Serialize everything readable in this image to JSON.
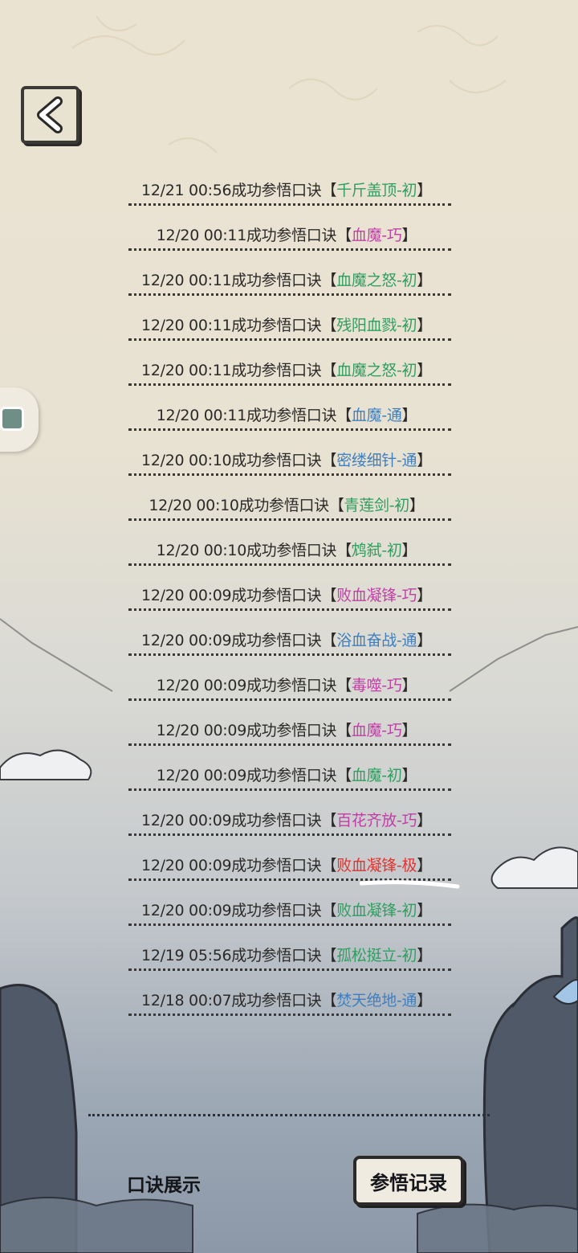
{
  "header": {
    "back_icon": "chevron-left-icon"
  },
  "side_tab": {
    "icon": "book-tab-icon"
  },
  "records": [
    {
      "prefix": "12/21 00:56成功参悟口诀",
      "skill": "千斤盖顶-初",
      "color": "#2f9e5f"
    },
    {
      "prefix": "12/20 00:11成功参悟口诀",
      "skill": "血魔-巧",
      "color": "#c03fa6"
    },
    {
      "prefix": "12/20 00:11成功参悟口诀",
      "skill": "血魔之怒-初",
      "color": "#2f9e5f"
    },
    {
      "prefix": "12/20 00:11成功参悟口诀",
      "skill": "残阳血戮-初",
      "color": "#2f9e5f"
    },
    {
      "prefix": "12/20 00:11成功参悟口诀",
      "skill": "血魔之怒-初",
      "color": "#2f9e5f"
    },
    {
      "prefix": "12/20 00:11成功参悟口诀",
      "skill": "血魔-通",
      "color": "#3f7fc0"
    },
    {
      "prefix": "12/20 00:10成功参悟口诀",
      "skill": "密缕细针-通",
      "color": "#3f7fc0"
    },
    {
      "prefix": "12/20 00:10成功参悟口诀",
      "skill": "青莲剑-初",
      "color": "#2f9e5f"
    },
    {
      "prefix": "12/20 00:10成功参悟口诀",
      "skill": "鸩弑-初",
      "color": "#2f9e5f"
    },
    {
      "prefix": "12/20 00:09成功参悟口诀",
      "skill": "败血凝锋-巧",
      "color": "#c03fa6"
    },
    {
      "prefix": "12/20 00:09成功参悟口诀",
      "skill": "浴血奋战-通",
      "color": "#3f7fc0"
    },
    {
      "prefix": "12/20 00:09成功参悟口诀",
      "skill": "毒噬-巧",
      "color": "#c03fa6"
    },
    {
      "prefix": "12/20 00:09成功参悟口诀",
      "skill": "血魔-巧",
      "color": "#c03fa6"
    },
    {
      "prefix": "12/20 00:09成功参悟口诀",
      "skill": "血魔-初",
      "color": "#2f9e5f"
    },
    {
      "prefix": "12/20 00:09成功参悟口诀",
      "skill": "百花齐放-巧",
      "color": "#c03fa6"
    },
    {
      "prefix": "12/20 00:09成功参悟口诀",
      "skill": "败血凝锋-极",
      "color": "#e0332f"
    },
    {
      "prefix": "12/20 00:09成功参悟口诀",
      "skill": "败血凝锋-初",
      "color": "#2f9e5f"
    },
    {
      "prefix": "12/19 05:56成功参悟口诀",
      "skill": "孤松挺立-初",
      "color": "#2f9e5f"
    },
    {
      "prefix": "12/18 00:07成功参悟口诀",
      "skill": "焚天绝地-通",
      "color": "#3f7fc0"
    }
  ],
  "brackets": {
    "open": "【",
    "close": "】"
  },
  "footer": {
    "tab_label": "口诀展示",
    "record_button": "参悟记录"
  }
}
